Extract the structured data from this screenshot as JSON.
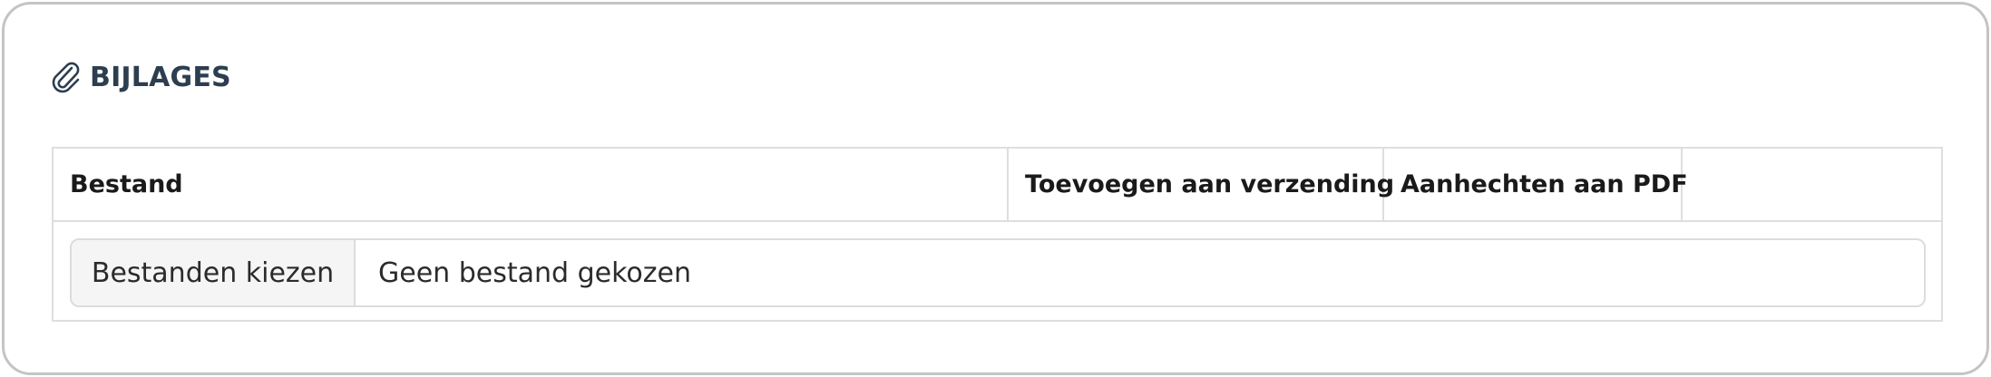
{
  "section": {
    "title": "BIJLAGES",
    "icon": "paperclip-icon",
    "title_color": "#2c3e50"
  },
  "table": {
    "columns": [
      "Bestand",
      "Toevoegen aan verzending",
      "Aanhechten aan PDF",
      ""
    ]
  },
  "file_input": {
    "button_label": "Bestanden kiezen",
    "status_text": "Geen bestand gekozen"
  }
}
